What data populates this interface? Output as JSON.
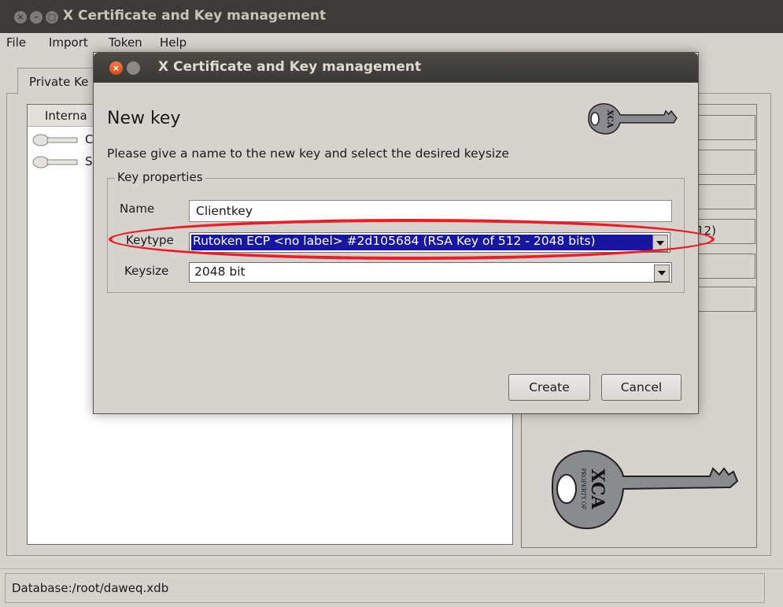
{
  "main_window": {
    "title": "X Certificate and Key management",
    "menu": [
      "File",
      "Import",
      "Token",
      "Help"
    ],
    "tab_label": "Private Ke",
    "list_header": "Interna",
    "list_rows": [
      "C",
      "S"
    ],
    "right_buttons": [
      "",
      "",
      "",
      "12)",
      "",
      ""
    ],
    "status": "Database:/root/daweq.xdb"
  },
  "dialog": {
    "title": "X Certificate and Key management",
    "heading": "New key",
    "info": "Please give a name to the new key and select the desired keysize",
    "group_title": "Key properties",
    "name_label": "Name",
    "name_value": "Clientkey",
    "keytype_label": "Keytype",
    "keytype_value": "Rutoken ECP <no label> #2d105684 (RSA Key of 512 - 2048 bits)",
    "keysize_label": "Keysize",
    "keysize_value": "2048 bit",
    "create_label": "Create",
    "cancel_label": "Cancel",
    "logo_text": "XCA",
    "logo_caption": "PROPERTY OF"
  },
  "colors": {
    "titlebar": "#3c3b37",
    "window_bg": "#d6d2cd",
    "selection": "#1616a0",
    "highlight_ellipse": "#ee1c24",
    "close_button": "#e8541f"
  },
  "icons": [
    "close-icon",
    "minimize-icon",
    "maximize-icon",
    "key-icon",
    "dropdown-arrow-icon"
  ]
}
